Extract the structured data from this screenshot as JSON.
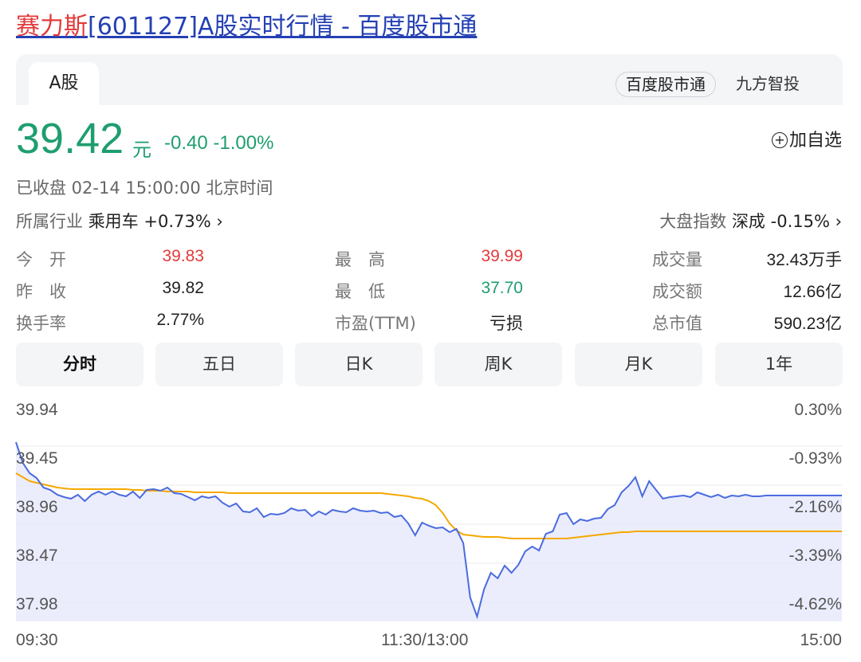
{
  "page": {
    "title_brand": "赛力斯",
    "title_rest": "[601127]A股实时行情 - 百度股市通"
  },
  "tabs": {
    "active": "A股",
    "source_selected": "百度股市通",
    "source_other": "九方智投"
  },
  "quote": {
    "price": "39.42",
    "unit": "元",
    "change": "-0.40 -1.00%",
    "watch_label": "加自选",
    "watch_icon": "plus-circle-icon",
    "status": "已收盘  02-14 15:00:00  北京时间"
  },
  "industry": {
    "label": "所属行业",
    "name": "乘用车",
    "change": "+0.73% ›"
  },
  "market": {
    "label": "大盘指数",
    "name": "深成",
    "change": "-0.15% ›"
  },
  "stats": [
    {
      "label": "今　开",
      "value": "39.83",
      "color": "red"
    },
    {
      "label": "昨　收",
      "value": "39.82",
      "color": "default"
    },
    {
      "label": "换手率",
      "value": "2.77%",
      "color": "default"
    },
    {
      "label": "最　高",
      "value": "39.99",
      "color": "red"
    },
    {
      "label": "最　低",
      "value": "37.70",
      "color": "green"
    },
    {
      "label": "市盈(TTM)",
      "value": "亏损",
      "color": "default"
    },
    {
      "label": "成交量",
      "value": "32.43万手",
      "color": "default"
    },
    {
      "label": "成交额",
      "value": "12.66亿",
      "color": "default"
    },
    {
      "label": "总市值",
      "value": "590.23亿",
      "color": "default"
    }
  ],
  "period_tabs": [
    "分时",
    "五日",
    "日K",
    "周K",
    "月K",
    "1年"
  ],
  "period_active": 0,
  "colors": {
    "up": "#e33a3a",
    "down": "#1e9e6e",
    "price_line": "#4a6bdf",
    "avg_line": "#f5a800",
    "fill": "#e6e9fb"
  },
  "chart_data": {
    "type": "line",
    "title": "",
    "xlabel": "",
    "ylabel": "",
    "x_ticks": [
      "09:30",
      "11:30/13:00",
      "15:00"
    ],
    "y_ticks": [
      "39.94",
      "39.45",
      "38.96",
      "38.47",
      "37.98"
    ],
    "y_pct_ticks": [
      "0.30%",
      "-0.93%",
      "-2.16%",
      "-3.39%",
      "-4.62%"
    ],
    "ylim": [
      37.74,
      40.18
    ],
    "x_minutes": [
      0,
      2,
      4,
      6,
      8,
      10,
      12,
      14,
      16,
      18,
      20,
      22,
      24,
      26,
      28,
      30,
      32,
      34,
      36,
      38,
      40,
      42,
      44,
      46,
      48,
      50,
      52,
      54,
      56,
      58,
      60,
      62,
      64,
      66,
      68,
      70,
      72,
      74,
      76,
      78,
      80,
      82,
      84,
      86,
      88,
      90,
      92,
      94,
      96,
      98,
      100,
      102,
      104,
      106,
      108,
      110,
      112,
      114,
      116,
      118,
      120,
      122,
      124,
      126,
      128,
      130,
      132,
      134,
      136,
      138,
      140,
      142,
      144,
      146,
      148,
      150,
      152,
      154,
      156,
      158,
      160,
      162,
      164,
      166,
      168,
      170,
      172,
      174,
      176,
      178,
      180,
      182,
      184,
      186,
      188,
      190,
      192,
      194,
      196,
      198,
      200,
      202,
      204,
      206,
      208,
      210,
      212,
      214,
      216,
      218,
      220,
      222,
      224,
      226,
      228,
      230,
      232,
      234,
      236,
      238,
      240
    ],
    "series": [
      {
        "name": "",
        "values": [
          39.99,
          39.73,
          39.6,
          39.54,
          39.42,
          39.39,
          39.33,
          39.3,
          39.28,
          39.33,
          39.25,
          39.33,
          39.37,
          39.33,
          39.37,
          39.33,
          39.31,
          39.37,
          39.29,
          39.39,
          39.4,
          39.38,
          39.42,
          39.35,
          39.34,
          39.3,
          39.26,
          39.31,
          39.29,
          39.31,
          39.23,
          39.18,
          39.22,
          39.12,
          39.11,
          39.16,
          39.05,
          39.09,
          39.08,
          39.1,
          39.16,
          39.13,
          39.14,
          39.06,
          39.12,
          39.08,
          39.14,
          39.12,
          39.11,
          39.16,
          39.13,
          39.12,
          39.13,
          39.1,
          39.11,
          39.05,
          39.07,
          38.97,
          38.82,
          38.98,
          38.94,
          38.91,
          38.92,
          38.86,
          38.9,
          38.72,
          38.04,
          37.8,
          38.14,
          38.35,
          38.28,
          38.44,
          38.35,
          38.45,
          38.62,
          38.68,
          38.63,
          38.84,
          38.87,
          39.08,
          39.1,
          38.96,
          39.02,
          39.0,
          39.03,
          39.04,
          39.15,
          39.2,
          39.36,
          39.44,
          39.55,
          39.31,
          39.5,
          39.39,
          39.28,
          39.3,
          39.31,
          39.32,
          39.3,
          39.36,
          39.33,
          39.3,
          39.33,
          39.29,
          39.32,
          39.31,
          39.33,
          39.31,
          39.31,
          39.32,
          39.32,
          39.32,
          39.32,
          39.32,
          39.32,
          39.32,
          39.32,
          39.32,
          39.32,
          39.32,
          39.32
        ]
      },
      {
        "name": "",
        "values": [
          39.6,
          39.55,
          39.5,
          39.48,
          39.46,
          39.44,
          39.42,
          39.41,
          39.4,
          39.4,
          39.4,
          39.4,
          39.4,
          39.4,
          39.4,
          39.4,
          39.4,
          39.39,
          39.39,
          39.38,
          39.38,
          39.38,
          39.37,
          39.37,
          39.37,
          39.37,
          39.36,
          39.36,
          39.36,
          39.36,
          39.36,
          39.35,
          39.35,
          39.35,
          39.35,
          39.35,
          39.35,
          39.35,
          39.35,
          39.35,
          39.35,
          39.35,
          39.35,
          39.35,
          39.35,
          39.35,
          39.35,
          39.35,
          39.35,
          39.35,
          39.35,
          39.35,
          39.35,
          39.35,
          39.34,
          39.33,
          39.32,
          39.31,
          39.29,
          39.28,
          39.25,
          39.2,
          39.1,
          38.97,
          38.88,
          38.83,
          38.82,
          38.81,
          38.8,
          38.8,
          38.8,
          38.79,
          38.78,
          38.78,
          38.78,
          38.78,
          38.78,
          38.78,
          38.78,
          38.78,
          38.78,
          38.79,
          38.8,
          38.81,
          38.82,
          38.83,
          38.84,
          38.85,
          38.86,
          38.86,
          38.87,
          38.87,
          38.87,
          38.87,
          38.87,
          38.87,
          38.87,
          38.87,
          38.87,
          38.87,
          38.87,
          38.87,
          38.87,
          38.87,
          38.87,
          38.87,
          38.87,
          38.87,
          38.87,
          38.87,
          38.87,
          38.87,
          38.87,
          38.87,
          38.87,
          38.87,
          38.87,
          38.87,
          38.87,
          38.87,
          38.87
        ]
      }
    ]
  }
}
